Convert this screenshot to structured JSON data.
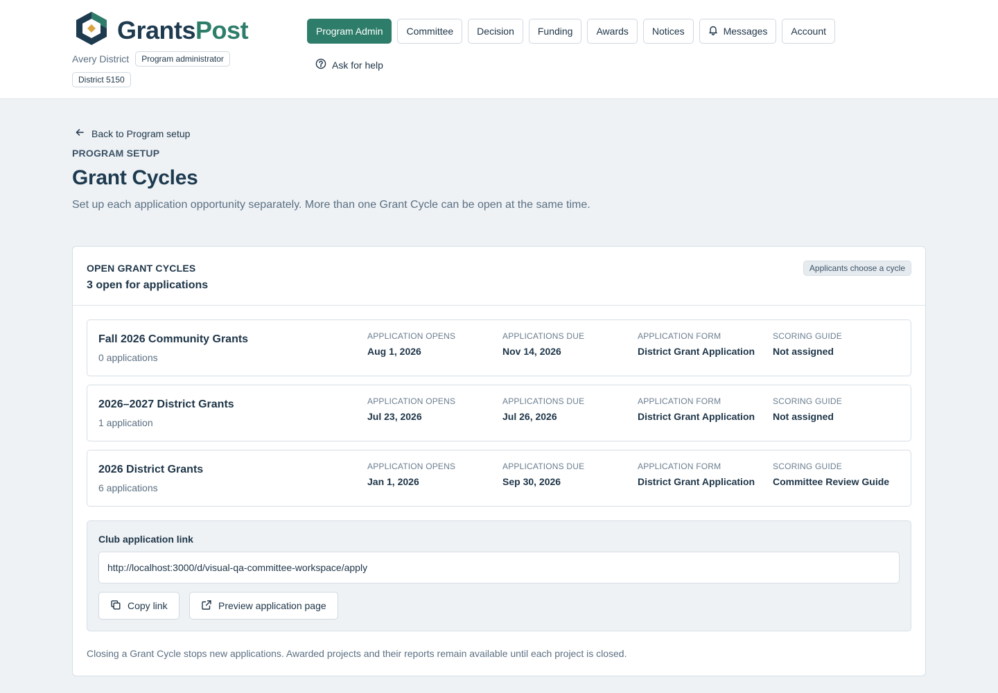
{
  "brand": {
    "name_part1": "Grants",
    "name_part2": "Post"
  },
  "org": {
    "name": "Avery District",
    "role": "Program administrator",
    "district": "District 5150"
  },
  "nav": {
    "items": [
      {
        "label": "Program Admin",
        "active": true
      },
      {
        "label": "Committee",
        "active": false
      },
      {
        "label": "Decision",
        "active": false
      },
      {
        "label": "Funding",
        "active": false
      },
      {
        "label": "Awards",
        "active": false
      },
      {
        "label": "Notices",
        "active": false
      },
      {
        "label": "Messages",
        "active": false,
        "icon": "bell-icon"
      },
      {
        "label": "Account",
        "active": false
      }
    ],
    "help_label": "Ask for help"
  },
  "page": {
    "back_label": "Back to Program setup",
    "eyebrow": "PROGRAM SETUP",
    "title": "Grant Cycles",
    "description": "Set up each application opportunity separately. More than one Grant Cycle can be open at the same time."
  },
  "cycles_card": {
    "eyebrow": "OPEN GRANT CYCLES",
    "subtitle": "3 open for applications",
    "badge": "Applicants choose a cycle",
    "field_labels": {
      "opens": "APPLICATION OPENS",
      "due": "APPLICATIONS DUE",
      "form": "APPLICATION FORM",
      "guide": "SCORING GUIDE"
    },
    "cycles": [
      {
        "name": "Fall 2026 Community Grants",
        "count": "0 applications",
        "opens": "Aug 1, 2026",
        "due": "Nov 14, 2026",
        "form": "District Grant Application",
        "guide": "Not assigned"
      },
      {
        "name": "2026–2027 District Grants",
        "count": "1 application",
        "opens": "Jul 23, 2026",
        "due": "Jul 26, 2026",
        "form": "District Grant Application",
        "guide": "Not assigned"
      },
      {
        "name": "2026 District Grants",
        "count": "6 applications",
        "opens": "Jan 1, 2026",
        "due": "Sep 30, 2026",
        "form": "District Grant Application",
        "guide": "Committee Review Guide"
      }
    ],
    "link_panel": {
      "label": "Club application link",
      "url": "http://localhost:3000/d/visual-qa-committee-workspace/apply",
      "copy_label": "Copy link",
      "preview_label": "Preview application page"
    },
    "footnote": "Closing a Grant Cycle stops new applications. Awarded projects and their reports remain available until each project is closed."
  },
  "colors": {
    "accent": "#2e7d6a",
    "brand_dark": "#1d3a4f",
    "page_bg": "#eef2f5"
  }
}
